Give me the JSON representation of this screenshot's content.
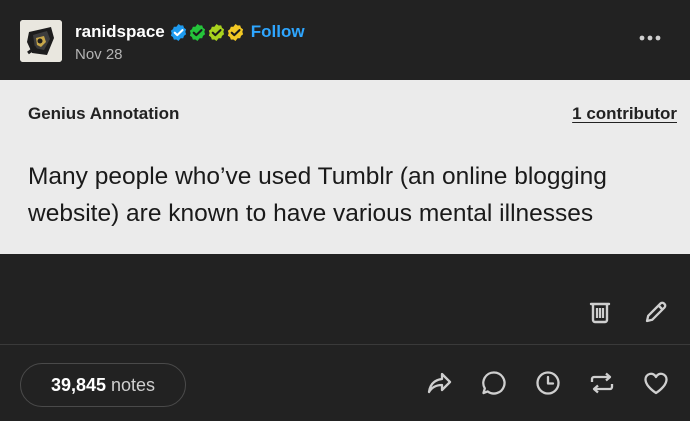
{
  "post": {
    "username": "ranidspace",
    "follow_label": "Follow",
    "date": "Nov 28",
    "badges": [
      {
        "name": "verified-badge-blue",
        "color": "#1e9bf0"
      },
      {
        "name": "verified-badge-green",
        "color": "#24c43a"
      },
      {
        "name": "verified-badge-yellowgreen",
        "color": "#a8d21e"
      },
      {
        "name": "verified-badge-yellow",
        "color": "#f2c824"
      }
    ],
    "more_icon": "more-dots-icon"
  },
  "annotation": {
    "title": "Genius Annotation",
    "contributors": "1 contributor",
    "body": "Many people who’ve used Tumblr (an online blogging website) are known to have various mental illnesses"
  },
  "tools": [
    "delete-icon",
    "edit-icon"
  ],
  "footer": {
    "notes_count": "39,845",
    "notes_label": "notes",
    "actions": [
      "share-icon",
      "reply-icon",
      "history-icon",
      "reblog-icon",
      "like-icon"
    ]
  },
  "colors": {
    "background": "#222222",
    "annotation_bg": "#ebebeb",
    "follow": "#2ea6ff"
  }
}
